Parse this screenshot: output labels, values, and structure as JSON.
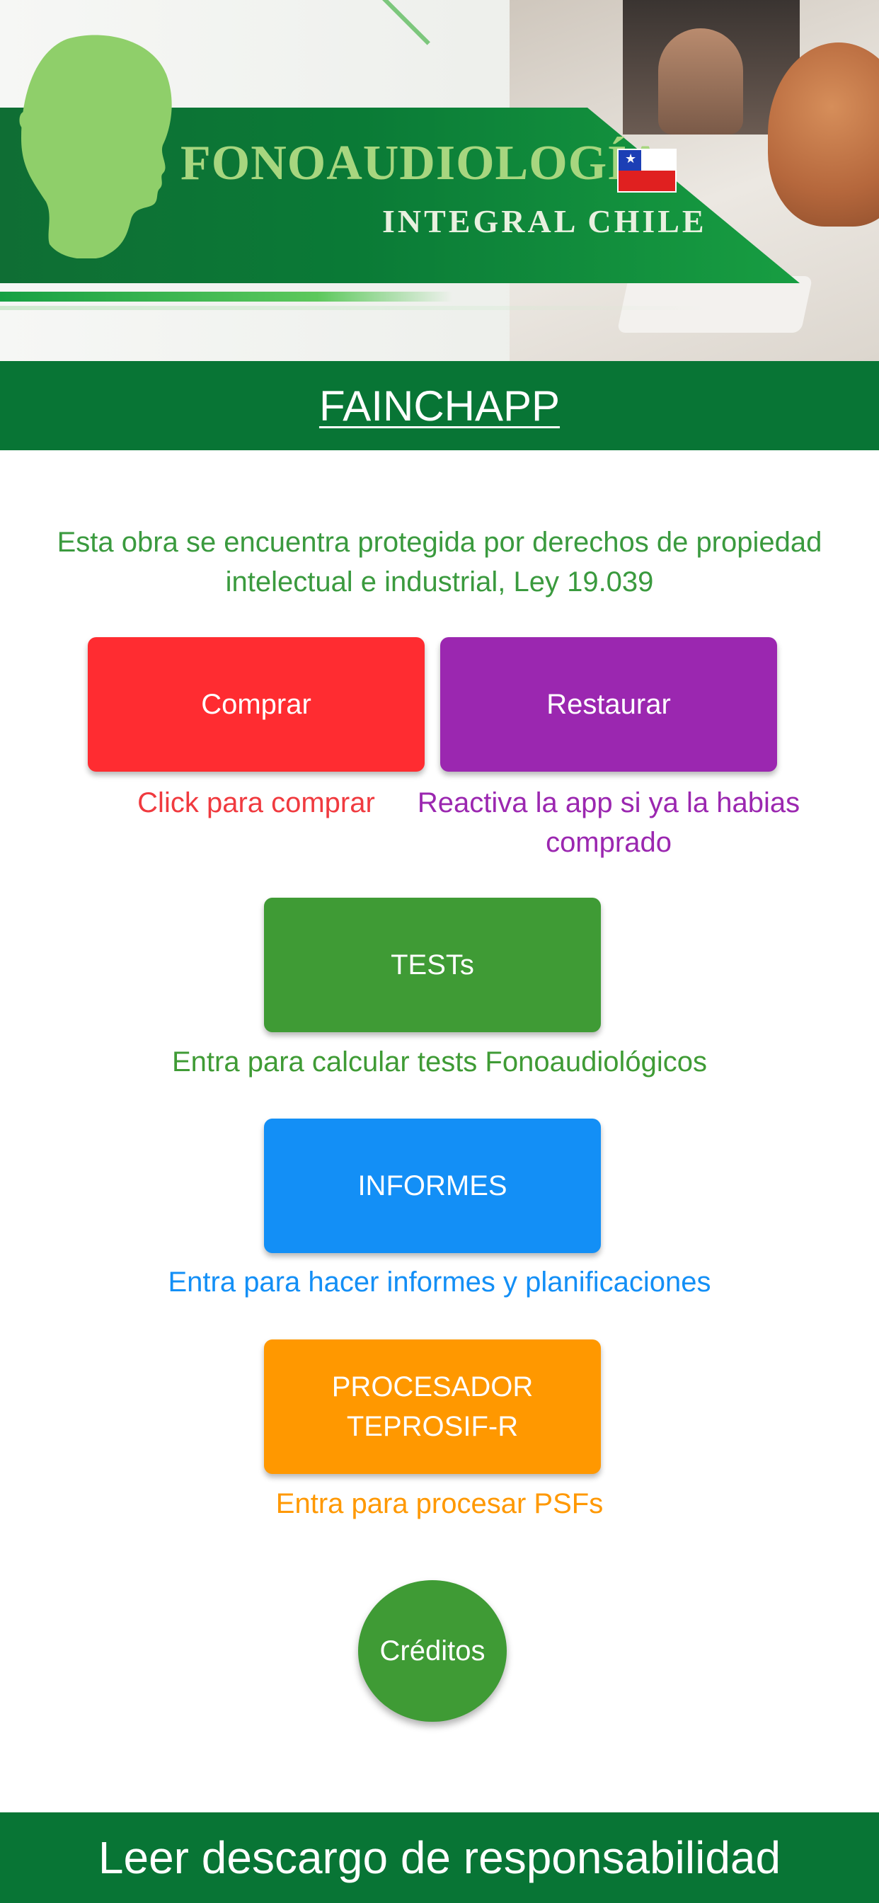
{
  "banner": {
    "brand_title": "FONOAUDIOLOGÍA",
    "brand_subtitle": "INTEGRAL CHILE"
  },
  "header": {
    "title": "FAINCHAPP"
  },
  "notice": {
    "text": "Esta obra se encuentra protegida por derechos de propiedad intelectual e industrial, Ley 19.039"
  },
  "buttons": {
    "comprar": {
      "label": "Comprar",
      "caption": "Click para comprar",
      "color": "#ff2c31"
    },
    "restaurar": {
      "label": "Restaurar",
      "caption": "Reactiva la app si ya la habias comprado",
      "color": "#9b27b0"
    },
    "tests": {
      "label": "TESTs",
      "caption": "Entra para calcular tests Fonoaudiológicos",
      "color": "#3f9b35"
    },
    "informes": {
      "label": "INFORMES",
      "caption": "Entra para hacer informes y planificaciones",
      "color": "#138ff6"
    },
    "procesador": {
      "label": "PROCESADOR TEPROSIF-R",
      "caption": "Entra para procesar PSFs",
      "color": "#ff9800"
    },
    "creditos": {
      "label": "Créditos",
      "color": "#3f9b35"
    }
  },
  "footer": {
    "label": "Leer descargo de responsabilidad"
  },
  "colors": {
    "primary_green": "#087535",
    "background": "#ffffff"
  },
  "icons": {
    "logo": "head-profile-icon",
    "flag": "chile-flag-icon"
  }
}
